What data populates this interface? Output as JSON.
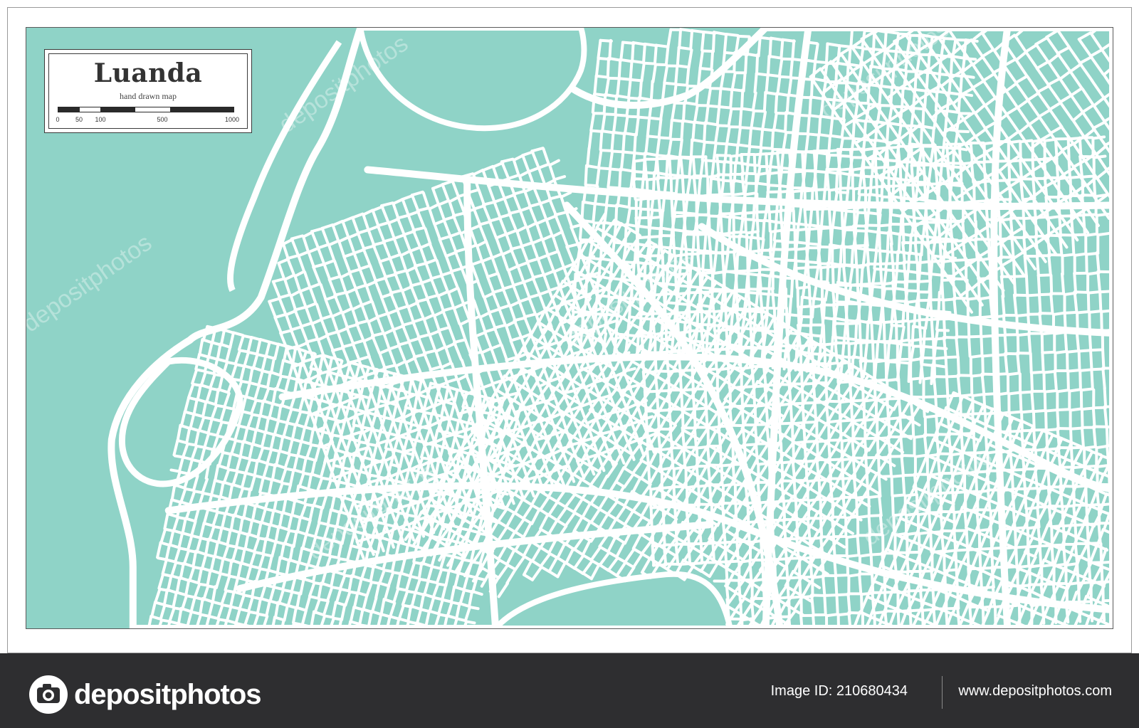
{
  "map": {
    "title": "Luanda",
    "subtitle": "hand drawn map",
    "scale": {
      "labels": [
        "0",
        "50",
        "100",
        "500",
        "1000"
      ]
    },
    "colors": {
      "water": "#8fd3c7",
      "land": "#8fd3c7",
      "road": "#ffffff",
      "frame": "#3a3a3a"
    }
  },
  "watermark": {
    "text": "depositphotos"
  },
  "footer": {
    "brand": "depositphotos",
    "logo_icon": "camera-icon",
    "image_id_label": "Image ID: 210680434",
    "site_url": "www.depositphotos.com",
    "background": "#2e2e30"
  }
}
